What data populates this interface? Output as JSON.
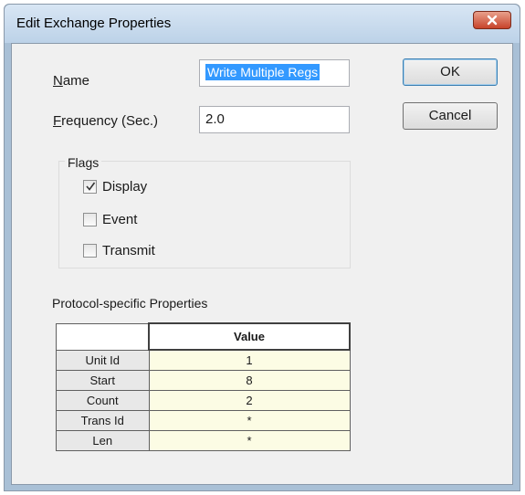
{
  "dialog": {
    "title": "Edit Exchange Properties",
    "close_icon": "close-icon"
  },
  "fields": {
    "name_label_mnemonic": "N",
    "name_label_rest": "ame",
    "name_value": "Write Multiple Regs",
    "frequency_label_mnemonic": "F",
    "frequency_label_rest": "requency (Sec.)",
    "frequency_value": "2.0"
  },
  "buttons": {
    "ok": "OK",
    "cancel": "Cancel"
  },
  "flags": {
    "title": "Flags",
    "items": [
      {
        "label": "Display",
        "checked": true
      },
      {
        "label": "Event",
        "checked": false
      },
      {
        "label": "Transmit",
        "checked": false
      }
    ]
  },
  "protocol": {
    "title": "Protocol-specific Properties",
    "column_header": "Value",
    "rows": [
      {
        "name": "Unit Id",
        "value": "1"
      },
      {
        "name": "Start",
        "value": "8"
      },
      {
        "name": "Count",
        "value": "2"
      },
      {
        "name": "Trans Id",
        "value": "*"
      },
      {
        "name": "Len",
        "value": "*"
      }
    ]
  },
  "colors": {
    "selection": "#3399ff",
    "value_cell": "#fcfce4",
    "close_button": "#c7432a"
  }
}
